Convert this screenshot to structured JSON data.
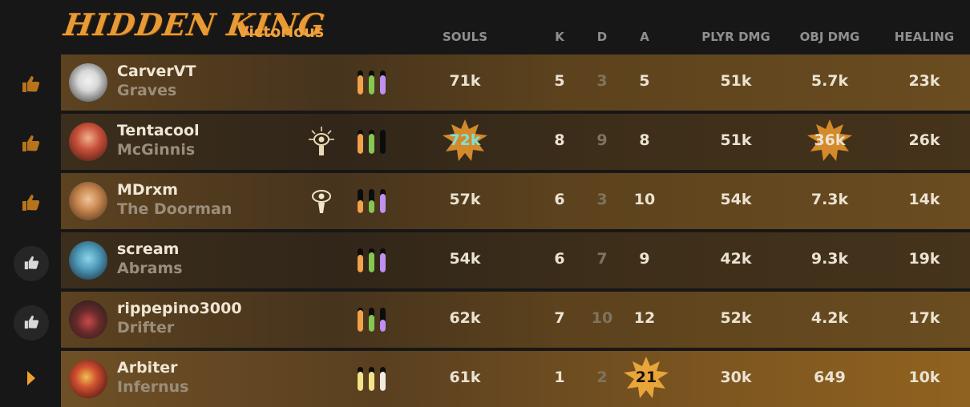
{
  "header": {
    "team_name": "HIDDEN KING",
    "result": "Victorious"
  },
  "columns": [
    "SOULS",
    "K",
    "D",
    "A",
    "PLYR DMG",
    "OBJ DMG",
    "HEALING"
  ],
  "players": [
    {
      "name": "CarverVT",
      "hero": "Graves",
      "souls": "71k",
      "k": "5",
      "d": "3",
      "a": "5",
      "plyr_dmg": "51k",
      "obj_dmg": "5.7k",
      "healing": "23k",
      "vote": "upvoted",
      "bars": [
        0.8,
        0.8,
        0.8
      ]
    },
    {
      "name": "Tentacool",
      "hero": "McGinnis",
      "souls": "72k",
      "k": "8",
      "d": "9",
      "a": "8",
      "plyr_dmg": "51k",
      "obj_dmg": "36k",
      "healing": "26k",
      "vote": "upvoted",
      "bars": [
        0.85,
        0.85,
        0.0
      ],
      "badge": "eye-sun-icon",
      "highlight_souls": true,
      "highlight_obj_dmg": true
    },
    {
      "name": "MDrxm",
      "hero": "The Doorman",
      "souls": "57k",
      "k": "6",
      "d": "3",
      "a": "10",
      "plyr_dmg": "54k",
      "obj_dmg": "7.3k",
      "healing": "14k",
      "vote": "upvoted",
      "bars": [
        0.55,
        0.55,
        0.8
      ],
      "badge": "eye-keyhole-icon"
    },
    {
      "name": "scream",
      "hero": "Abrams",
      "souls": "54k",
      "k": "6",
      "d": "7",
      "a": "9",
      "plyr_dmg": "42k",
      "obj_dmg": "9.3k",
      "healing": "19k",
      "vote": "upvote-button",
      "bars": [
        0.75,
        0.85,
        0.8
      ]
    },
    {
      "name": "rippepino3000",
      "hero": "Drifter",
      "souls": "62k",
      "k": "7",
      "d": "10",
      "a": "12",
      "plyr_dmg": "52k",
      "obj_dmg": "4.2k",
      "healing": "17k",
      "vote": "upvote-button",
      "bars": [
        0.9,
        0.7,
        0.5
      ]
    },
    {
      "name": "Arbiter",
      "hero": "Infernus",
      "souls": "61k",
      "k": "1",
      "d": "2",
      "a": "21",
      "plyr_dmg": "30k",
      "obj_dmg": "649",
      "healing": "10k",
      "vote": "self",
      "bars": [
        0.8,
        0.8,
        0.8
      ],
      "highlight_a": true
    }
  ],
  "colors": {
    "accent": "#f0a23f",
    "bar_orange": "#f2a24a",
    "bar_green": "#86c653",
    "bar_purple": "#c08ff0",
    "bar_yellow": "#f2e48a"
  }
}
